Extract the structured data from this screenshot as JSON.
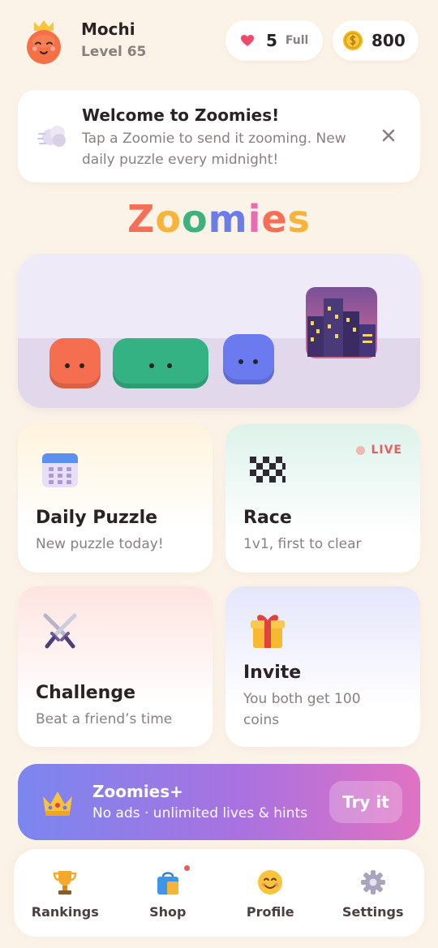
{
  "user": {
    "name": "Mochi",
    "level": "Level 65"
  },
  "lives": {
    "count": "5",
    "status": "Full"
  },
  "coins": {
    "count": "800"
  },
  "banner": {
    "title": "Welcome to Zoomies!",
    "text": "Tap a Zoomie to send it zooming. New daily puzzle every midnight!"
  },
  "logo": {
    "letters": [
      {
        "char": "Z",
        "color": "#f56e57"
      },
      {
        "char": "o",
        "color": "#f7b43a"
      },
      {
        "char": "o",
        "color": "#3db27f"
      },
      {
        "char": "m",
        "color": "#6b7de8"
      },
      {
        "char": "i",
        "color": "#e96bb0"
      },
      {
        "char": "e",
        "color": "#f56e57"
      },
      {
        "char": "s",
        "color": "#f7b43a"
      }
    ]
  },
  "hero": {
    "zoomies": [
      {
        "name": "red",
        "color": "#f56e4f"
      },
      {
        "name": "green",
        "color": "#34b283"
      },
      {
        "name": "blue",
        "color": "#6c7af0"
      }
    ]
  },
  "modes": {
    "daily": {
      "title": "Daily Puzzle",
      "sub": "New puzzle today!"
    },
    "race": {
      "title": "Race",
      "sub": "1v1, first to clear",
      "badge": "LIVE"
    },
    "challenge": {
      "title": "Challenge",
      "sub": "Beat a friend’s time"
    },
    "invite": {
      "title": "Invite",
      "sub": "You both get 100 coins"
    }
  },
  "promo": {
    "title": "Zoomies+",
    "sub": "No ads · unlimited lives & hints",
    "button": "Try it"
  },
  "tabs": {
    "rankings": "Rankings",
    "shop": "Shop",
    "profile": "Profile",
    "settings": "Settings"
  },
  "colors": {
    "background": "#fcf3e8",
    "accent_red": "#e85d5d",
    "promo_gradient": [
      "#7b86ef",
      "#a872e0",
      "#e172c2"
    ]
  },
  "icons": [
    "crown-avatar-icon",
    "heart-icon",
    "coin-icon",
    "cloud-icon",
    "close-icon",
    "calendar-icon",
    "checkered-flag-icon",
    "crossed-swords-icon",
    "gift-icon",
    "crown-icon",
    "trophy-icon",
    "shopping-bag-icon",
    "smiley-icon",
    "gear-icon"
  ]
}
